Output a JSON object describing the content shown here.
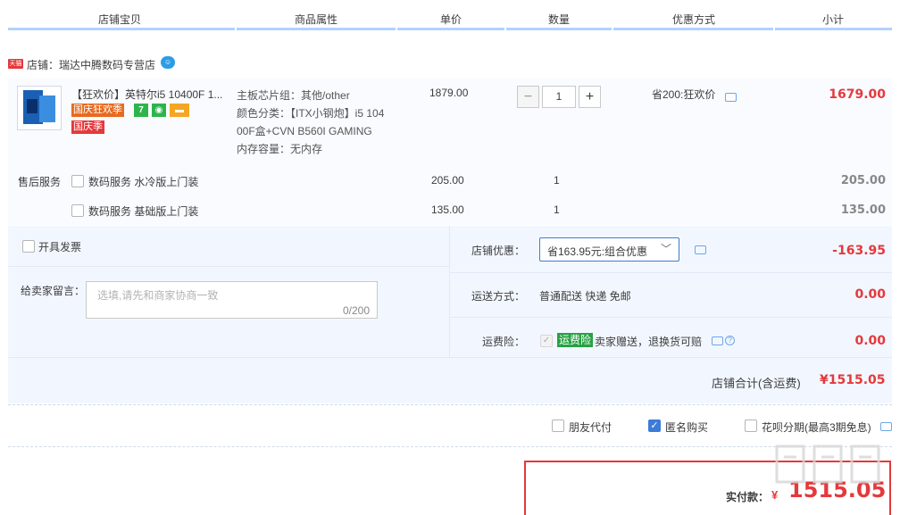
{
  "header": {
    "columns": [
      "店铺宝贝",
      "商品属性",
      "单价",
      "数量",
      "优惠方式",
      "小计"
    ]
  },
  "shop": {
    "badge": "天猫",
    "name": "店铺：瑞达中腾数码专营店"
  },
  "item": {
    "title": "【狂欢价】英特尔i5 10400F 1...",
    "tags": [
      "国庆狂欢季",
      "国庆季"
    ],
    "props": [
      "主板芯片组：其他/other",
      "颜色分类：【ITX小钢炮】i5 104",
      "00F盒+CVN B560I GAMING",
      "内存容量：无内存"
    ],
    "price": "1879.00",
    "qty": "1",
    "qty_minus": "−",
    "qty_plus": "+",
    "promo": "省200:狂欢价",
    "subtotal": "1679.00"
  },
  "services": {
    "label": "售后服务",
    "items": [
      {
        "name": "数码服务 水冷版上门装",
        "price": "205.00",
        "qty": "1",
        "subtotal": "205.00"
      },
      {
        "name": "数码服务 基础版上门装",
        "price": "135.00",
        "qty": "1",
        "subtotal": "135.00"
      }
    ]
  },
  "invoice": {
    "label": "开具发票"
  },
  "message": {
    "label": "给卖家留言：",
    "placeholder": "选填,请先和商家协商一致",
    "count": "0/200"
  },
  "shop_discount": {
    "label": "店铺优惠：",
    "selected": "省163.95元:组合优惠",
    "value": "-163.95"
  },
  "shipping": {
    "label": "运送方式：",
    "text": "普通配送 快递 免邮",
    "value": "0.00"
  },
  "insurance": {
    "label": "运费险：",
    "tag": "运费险",
    "text": "卖家赠送，退换货可赔",
    "value": "0.00"
  },
  "shop_total": {
    "label": "店铺合计(含运费)",
    "value": "¥1515.05"
  },
  "options": {
    "friend_pay": "朋友代付",
    "anonymous": "匿名购买",
    "huabei": "花呗分期(最高3期免息)"
  },
  "pay": {
    "label": "实付款：",
    "symbol": "¥",
    "value": "1515.05"
  },
  "colors": {
    "accent_red": "#e4393c",
    "header_line": "#b2d1ff",
    "panel_bg": "#f2f7ff",
    "check_blue": "#3d7bd9"
  }
}
